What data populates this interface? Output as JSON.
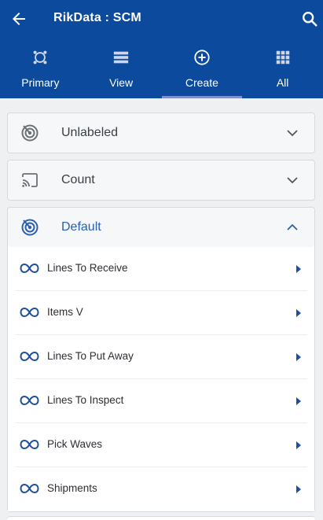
{
  "app": {
    "title": "RikData : SCM"
  },
  "nav": {
    "tabs": [
      {
        "label": "Primary",
        "icon": "primary-icon",
        "active": false
      },
      {
        "label": "View",
        "icon": "list-view-icon",
        "active": false
      },
      {
        "label": "Create",
        "icon": "add-circle-icon",
        "active": true
      },
      {
        "label": "All",
        "icon": "grid-icon",
        "active": false
      }
    ]
  },
  "panels": [
    {
      "title": "Unlabeled",
      "icon": "radar-icon",
      "expanded": false
    },
    {
      "title": "Count",
      "icon": "cast-icon",
      "expanded": false
    },
    {
      "title": "Default",
      "icon": "radar-icon",
      "expanded": true,
      "items": [
        {
          "label": "Lines To Receive",
          "icon": "link-icon"
        },
        {
          "label": "Items V",
          "icon": "link-icon"
        },
        {
          "label": "Lines To Put Away",
          "icon": "link-icon"
        },
        {
          "label": "Lines To Inspect",
          "icon": "link-icon"
        },
        {
          "label": "Pick Waves",
          "icon": "link-icon"
        },
        {
          "label": "Shipments",
          "icon": "link-icon"
        }
      ]
    }
  ],
  "colors": {
    "header": "#0b4a9c",
    "accent": "#2a5fb0",
    "tab_indicator": "#7e8fd6",
    "row_icon": "#1f4f9a",
    "panel_icon": "#6b7075"
  }
}
